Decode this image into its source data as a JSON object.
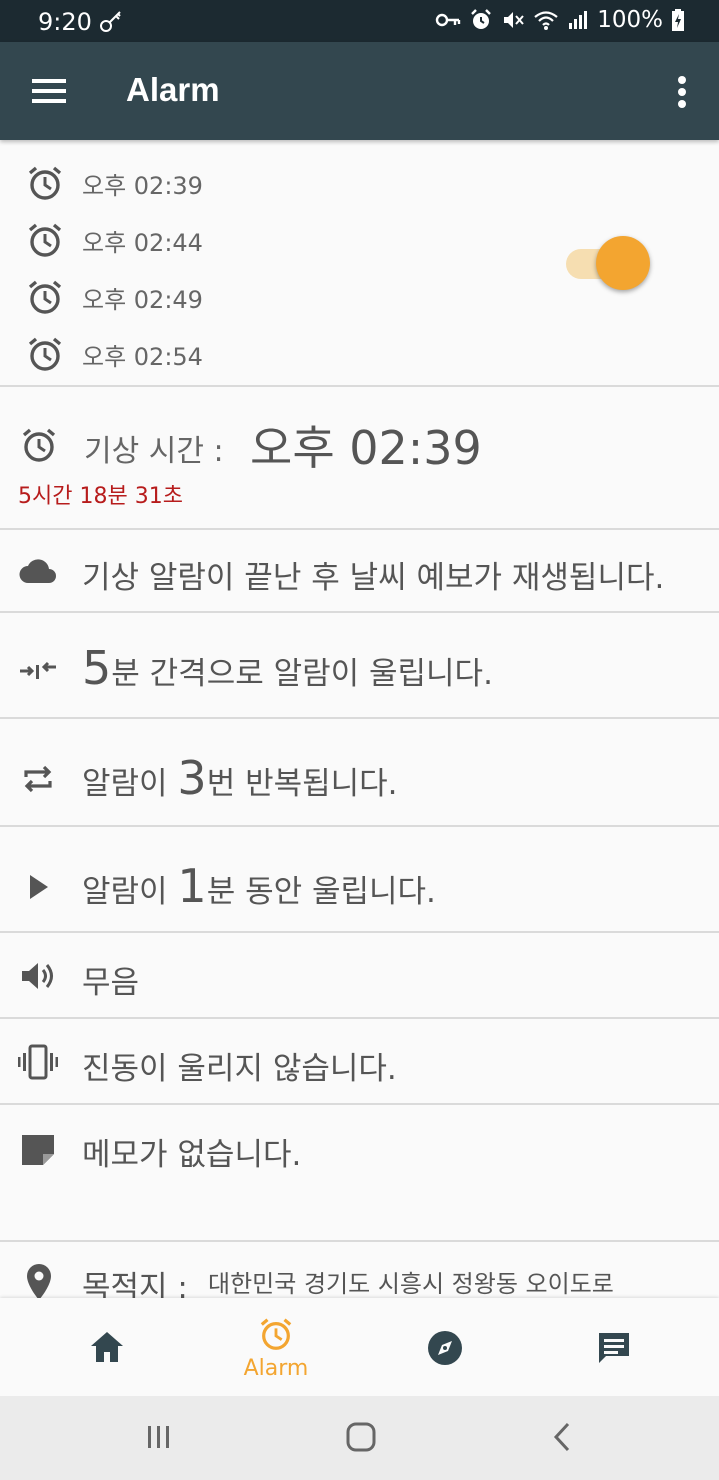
{
  "status_bar": {
    "time": "9:20",
    "battery": "100%",
    "icons": [
      "key-icon",
      "alarm-status-icon",
      "mute-icon",
      "wifi-icon",
      "signal-icon",
      "battery-charging-icon"
    ]
  },
  "app_bar": {
    "title": "Alarm",
    "menu_icon": "hamburger-menu-icon",
    "more_icon": "more-vert-icon"
  },
  "alarms": [
    {
      "time": "오후 02:39"
    },
    {
      "time": "오후 02:44"
    },
    {
      "time": "오후 02:49"
    },
    {
      "time": "오후 02:54"
    }
  ],
  "alarm_toggle": {
    "on": true
  },
  "wake": {
    "label": "기상 시간 :",
    "value": "오후 02:39",
    "remaining": "5시간 18분 31초"
  },
  "weather": {
    "text": "기상 알람이 끝난 후 날씨 예보가 재생됩니다."
  },
  "interval": {
    "number": "5",
    "text": "분 간격으로 알람이 울립니다."
  },
  "repeat": {
    "prefix": "알람이 ",
    "number": "3",
    "text": "번 반복됩니다."
  },
  "duration": {
    "prefix": "알람이 ",
    "number": "1",
    "text": "분 동안 울립니다."
  },
  "sound": {
    "text": "무음"
  },
  "vibration": {
    "text": "진동이 울리지 않습니다."
  },
  "memo": {
    "text": "메모가 없습니다."
  },
  "destination": {
    "label": "목적지 :",
    "address": "대한민국 경기도 시흥시 정왕동 오이도로"
  },
  "bottom_nav": {
    "items": [
      {
        "icon": "home-icon",
        "label": ""
      },
      {
        "icon": "alarm-icon",
        "label": "Alarm"
      },
      {
        "icon": "compass-icon",
        "label": ""
      },
      {
        "icon": "chat-icon",
        "label": ""
      }
    ]
  },
  "colors": {
    "accent": "#f3a530",
    "app_bar": "#33474f",
    "status_bar": "#1c2a31",
    "countdown": "#b71c1c"
  }
}
